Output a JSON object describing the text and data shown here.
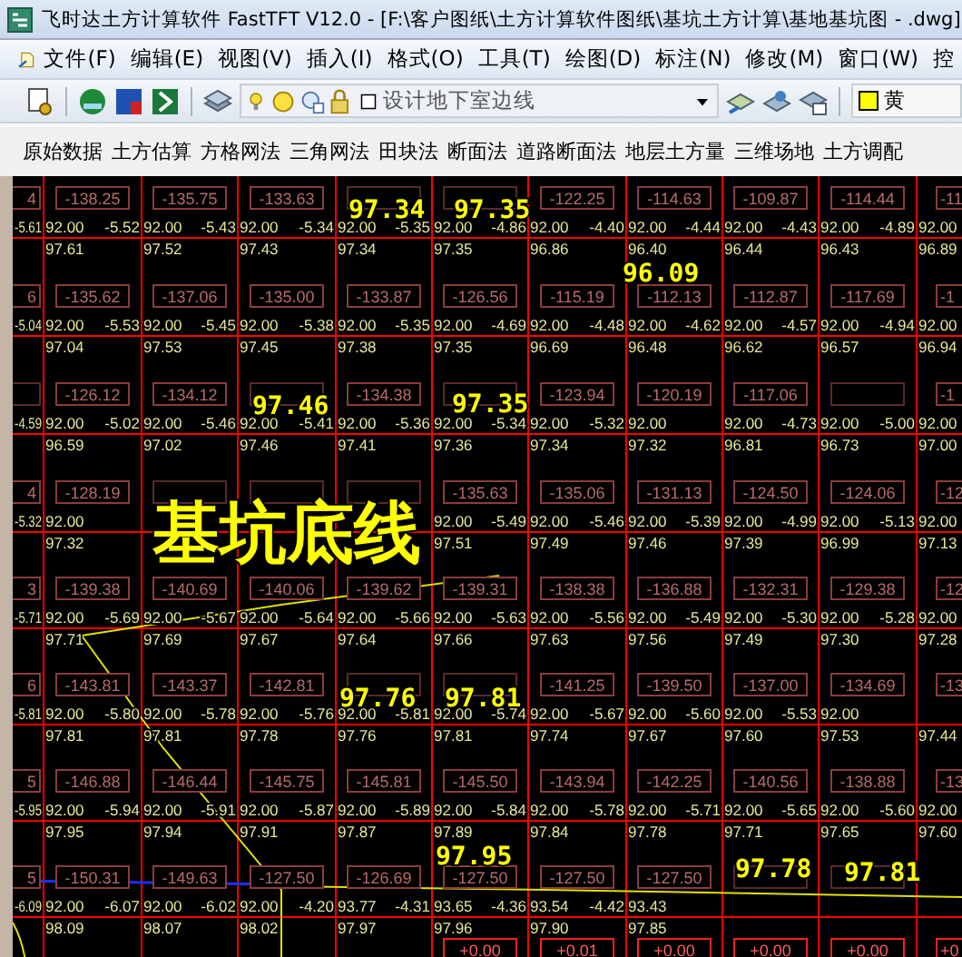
{
  "window": {
    "title": "飞时达土方计算软件 FastTFT V12.0 - [F:\\客户图纸\\土方计算软件图纸\\基坑土方计算\\基地基坑图 - .dwg]"
  },
  "menu": [
    "文件(F)",
    "编辑(E)",
    "视图(V)",
    "插入(I)",
    "格式(O)",
    "工具(T)",
    "绘图(D)",
    "标注(N)",
    "修改(M)",
    "窗口(W)",
    "控"
  ],
  "toolbar": {
    "layer": "设计地下室边线",
    "color_name": "黄"
  },
  "tabs": [
    "原始数据",
    "土方估算",
    "方格网法",
    "三角网法",
    "田块法",
    "断面法",
    "道路断面法",
    "地层土方量",
    "三维场地",
    "土方调配"
  ],
  "drawing": {
    "rows": [
      {
        "boxes": [
          "4",
          "-138.25",
          "-135.75",
          "-133.63",
          {
            "covered": true
          },
          {
            "covered": true
          },
          "-122.25",
          "-114.63",
          "-109.87",
          "-114.44",
          "-11"
        ],
        "nodes": [
          {
            "cut": "-5.61",
            "design": "92.00",
            "ground": "97.61"
          },
          {
            "cut": "-5.52",
            "design": "92.00",
            "ground": "97.52"
          },
          {
            "cut": "-5.43",
            "design": "92.00",
            "ground": "97.43"
          },
          {
            "cut": "-5.34",
            "design": "92.00",
            "ground": "97.34"
          },
          {
            "cut": "-5.35",
            "design": "92.00",
            "ground": "97.35"
          },
          {
            "cut": "-4.86",
            "design": "92.00",
            "ground": "96.86"
          },
          {
            "cut": "-4.40",
            "design": "92.00",
            "ground": "96.40"
          },
          {
            "cut": "-4.44",
            "design": "92.00",
            "ground": "96.44"
          },
          {
            "cut": "-4.43",
            "design": "92.00",
            "ground": "96.43"
          },
          {
            "cut": "-4.89",
            "design": "92.00",
            "ground": "96.89"
          }
        ]
      },
      {
        "boxes": [
          "6",
          "-135.62",
          "-137.06",
          "-135.00",
          "-133.87",
          "-126.56",
          "-115.19",
          "-112.13",
          "-112.87",
          "-117.69",
          "-1"
        ],
        "nodes": [
          {
            "cut": "-5.04",
            "design": "92.00",
            "ground": "97.04"
          },
          {
            "cut": "-5.53",
            "design": "92.00",
            "ground": "97.53"
          },
          {
            "cut": "-5.45",
            "design": "92.00",
            "ground": "97.45"
          },
          {
            "cut": "-5.38",
            "design": "92.00",
            "ground": "97.38"
          },
          {
            "cut": "-5.35",
            "design": "92.00",
            "ground": "97.35"
          },
          {
            "cut": "-4.69",
            "design": "92.00",
            "ground": "96.69"
          },
          {
            "cut": "-4.48",
            "design": "92.00",
            "ground": "96.48"
          },
          {
            "cut": "-4.62",
            "design": "92.00",
            "ground": "96.62"
          },
          {
            "cut": "-4.57",
            "design": "92.00",
            "ground": "96.57"
          },
          {
            "cut": "-4.94",
            "design": "92.00",
            "ground": "96.94"
          }
        ]
      },
      {
        "boxes": [
          {
            "covered": true
          },
          "-126.12",
          "-134.12",
          {
            "covered": true
          },
          "-134.38",
          {
            "covered": true
          },
          "-123.94",
          "-120.19",
          "-117.06",
          {
            "covered": true
          },
          "-1"
        ],
        "nodes": [
          {
            "cut": "-4.59",
            "design": "92.00",
            "ground": "96.59"
          },
          {
            "cut": "-5.02",
            "design": "92.00",
            "ground": "97.02"
          },
          {
            "cut": "-5.46",
            "design": "92.00",
            "ground": "97.46"
          },
          {
            "cut": "-5.41",
            "design": "92.00",
            "ground": "97.41"
          },
          {
            "cut": "-5.36",
            "design": "92.00",
            "ground": "97.36"
          },
          {
            "cut": "-5.34",
            "design": "92.00",
            "ground": "97.34"
          },
          {
            "cut": "-5.32",
            "design": "92.00",
            "ground": "97.32"
          },
          {
            "design": "92.00",
            "ground": "96.81"
          },
          {
            "cut": "-4.73",
            "design": "92.00",
            "ground": "96.73"
          },
          {
            "cut": "-5.00",
            "design": "92.00",
            "ground": "97.00"
          }
        ]
      },
      {
        "boxes": [
          "4",
          "-128.19",
          {
            "covered": true
          },
          {
            "covered": true
          },
          {
            "covered": true
          },
          "-135.63",
          "-135.06",
          "-131.13",
          "-124.50",
          "-124.06",
          "-12"
        ],
        "nodes": [
          {
            "cut": "-5.32",
            "design": "92.00",
            "ground": "97.32"
          }
        ],
        "nodes_right": [
          {
            "design": "92.00",
            "ground": "97.51"
          },
          {
            "cut": "-5.49",
            "design": "92.00",
            "ground": "97.49"
          },
          {
            "cut": "-5.46",
            "design": "92.00",
            "ground": "97.46"
          },
          {
            "cut": "-5.39",
            "design": "92.00",
            "ground": "97.39"
          },
          {
            "cut": "-4.99",
            "design": "92.00",
            "ground": "96.99"
          },
          {
            "cut": "-5.13",
            "design": "92.00",
            "ground": "97.13"
          }
        ]
      },
      {
        "boxes": [
          "3",
          "-139.38",
          "-140.69",
          "-140.06",
          "-139.62",
          "-139.31",
          "-138.38",
          "-136.88",
          "-132.31",
          "-129.38",
          "-12"
        ],
        "nodes": [
          {
            "cut": "-5.71",
            "design": "92.00",
            "ground": "97.71"
          },
          {
            "cut": "-5.69",
            "design": "92.00",
            "ground": "97.69"
          },
          {
            "cut": "-5.67",
            "design": "92.00",
            "ground": "97.67"
          },
          {
            "cut": "-5.64",
            "design": "92.00",
            "ground": "97.64"
          },
          {
            "cut": "-5.66",
            "design": "92.00",
            "ground": "97.66"
          },
          {
            "cut": "-5.63",
            "design": "92.00",
            "ground": "97.63"
          },
          {
            "cut": "-5.56",
            "design": "92.00",
            "ground": "97.56"
          },
          {
            "cut": "-5.49",
            "design": "92.00",
            "ground": "97.49"
          },
          {
            "cut": "-5.30",
            "design": "92.00",
            "ground": "97.30"
          },
          {
            "cut": "-5.28",
            "design": "92.00",
            "ground": "97.28"
          }
        ]
      },
      {
        "boxes": [
          "6",
          "-143.81",
          "-143.37",
          "-142.81",
          {
            "covered": true
          },
          {
            "covered": true
          },
          "-141.25",
          "-139.50",
          "-137.00",
          "-134.69",
          "-13"
        ],
        "nodes": [
          {
            "cut": "-5.81",
            "design": "92.00",
            "ground": "97.81"
          },
          {
            "cut": "-5.80",
            "design": "92.00",
            "ground": "97.81"
          },
          {
            "cut": "-5.78",
            "design": "92.00",
            "ground": "97.78"
          },
          {
            "cut": "-5.76",
            "design": "92.00",
            "ground": "97.76"
          },
          {
            "cut": "-5.81",
            "design": "92.00",
            "ground": "97.81"
          },
          {
            "cut": "-5.74",
            "design": "92.00",
            "ground": "97.74"
          },
          {
            "cut": "-5.67",
            "design": "92.00",
            "ground": "97.67"
          },
          {
            "cut": "-5.60",
            "design": "92.00",
            "ground": "97.60"
          },
          {
            "cut": "-5.53",
            "design": "92.00",
            "ground": "97.53"
          },
          {
            "ground": "97.44"
          }
        ]
      },
      {
        "boxes": [
          "5",
          "-146.88",
          "-146.44",
          "-145.75",
          "-145.81",
          "-145.50",
          "-143.94",
          "-142.25",
          "-140.56",
          "-138.88",
          "-13"
        ],
        "nodes": [
          {
            "cut": "-5.95",
            "design": "92.00",
            "ground": "97.95"
          },
          {
            "cut": "-5.94",
            "design": "92.00",
            "ground": "97.94"
          },
          {
            "cut": "-5.91",
            "design": "92.00",
            "ground": "97.91"
          },
          {
            "cut": "-5.87",
            "design": "92.00",
            "ground": "97.87"
          },
          {
            "cut": "-5.89",
            "design": "92.00",
            "ground": "97.89"
          },
          {
            "cut": "-5.84",
            "design": "92.00",
            "ground": "97.84"
          },
          {
            "cut": "-5.78",
            "design": "92.00",
            "ground": "97.78"
          },
          {
            "cut": "-5.71",
            "design": "92.00",
            "ground": "97.71"
          },
          {
            "cut": "-5.65",
            "design": "92.00",
            "ground": "97.65"
          },
          {
            "cut": "-5.60",
            "design": "92.00",
            "ground": "97.60"
          }
        ]
      },
      {
        "boxes": [
          "5",
          "-150.31",
          "-149.63",
          "-127.50",
          "-126.69",
          "-127.50",
          "-127.50",
          "-127.50",
          {
            "covered": true
          },
          {
            "covered": true
          }
        ],
        "nodes": [
          {
            "cut": "-6.09",
            "design": "92.00",
            "ground": "98.09"
          },
          {
            "cut": "-6.07",
            "design": "92.00",
            "ground": "98.07"
          },
          {
            "cut": "-6.02",
            "design": "92.00",
            "ground": "98.02"
          },
          {
            "cut": "-4.20",
            "design": "93.77",
            "ground": "97.97"
          },
          {
            "cut": "-4.31",
            "design": "93.65",
            "ground": "97.96"
          },
          {
            "cut": "-4.36",
            "design": "93.54",
            "ground": "97.90"
          },
          {
            "cut": "-4.42",
            "design": "93.43",
            "ground": "97.85"
          }
        ]
      }
    ],
    "bottom_boxes": [
      "+0.00",
      "+0.01",
      "+0.00",
      "+0.00",
      "+0.00",
      "+0"
    ],
    "markers": [
      "97.34",
      "97.35",
      "96.09",
      "97.46",
      "97.35",
      "97.76",
      "97.81",
      "97.95",
      "97.78",
      "97.81"
    ],
    "annotation": "基坑底线"
  }
}
